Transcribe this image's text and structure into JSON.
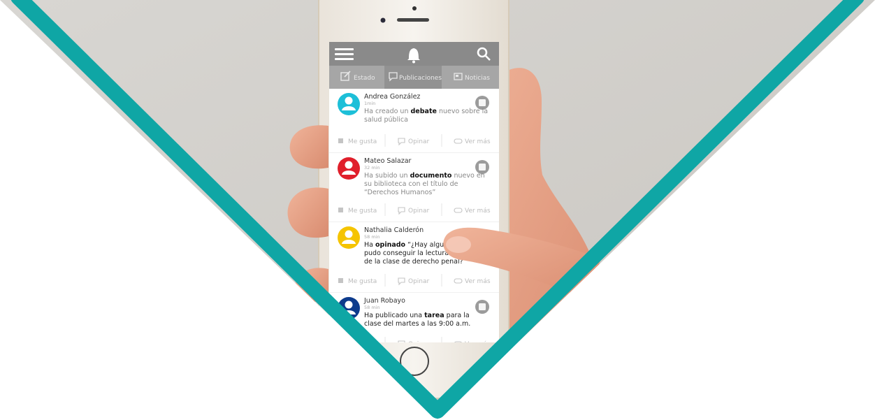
{
  "colors": {
    "frame": "#0fa6a5",
    "background": "#d3d0cc",
    "appbar": "#8a8a8a",
    "tabbar": "#a6a6a6",
    "tab_active": "#929292"
  },
  "appbar": {
    "icons": [
      "menu-icon",
      "bell-icon",
      "search-icon"
    ]
  },
  "tabs": [
    {
      "label": "Estado",
      "icon": "edit-icon"
    },
    {
      "label": "Publicaciones",
      "icon": "comment-icon",
      "active": true
    },
    {
      "label": "Noticias",
      "icon": "news-icon"
    }
  ],
  "actions": {
    "like": "Me gusta",
    "comment": "Opinar",
    "more": "Ver más"
  },
  "posts": [
    {
      "author": "Andrea González",
      "time": "1min",
      "avatar_color": "#1dbfd8",
      "line1_pre": "Ha creado un ",
      "line1_bold": "debate",
      "line1_post": " nuevo sobre la",
      "line2": "salud pública",
      "badge_icon": "group-icon"
    },
    {
      "author": "Mateo Salazar",
      "time": "32 min",
      "avatar_color": "#e01f2b",
      "line1_pre": "Ha subido un ",
      "line1_bold": "documento",
      "line1_post": " nuevo en",
      "line2": "su biblioteca con el título de",
      "line3": "“Derechos Humanos”",
      "badge_icon": "book-icon"
    },
    {
      "author": "Nathalia Calderón",
      "time": "58 min",
      "avatar_color": "#f5c400",
      "line1_pre": "Ha ",
      "line1_bold": "opinado",
      "line1_post": " “¿Hay alguien",
      "line2": "pudo conseguir la lectura co",
      "line3": "de la clase de derecho penal?",
      "badge_icon": "chat-icon"
    },
    {
      "author": "Juan Robayo",
      "time": "58 min",
      "avatar_color": "#0d3b8c",
      "line1_pre": "Ha publicado una ",
      "line1_bold": "tarea",
      "line1_post": " para la",
      "line2": "clase del martes a las 9:00 a.m.",
      "badge_icon": "file-icon"
    }
  ]
}
